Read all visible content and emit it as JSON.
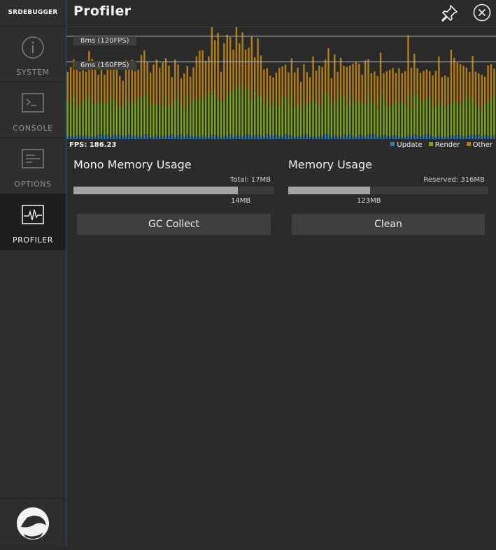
{
  "app": {
    "brand": "SRDEBUGGER"
  },
  "sidebar": {
    "items": [
      {
        "label": "SYSTEM",
        "icon": "info-icon",
        "active": false
      },
      {
        "label": "CONSOLE",
        "icon": "terminal-icon",
        "active": false
      },
      {
        "label": "OPTIONS",
        "icon": "options-list-icon",
        "active": false
      },
      {
        "label": "PROFILER",
        "icon": "heartbeat-icon",
        "active": true
      }
    ],
    "logo_icon": "srdebugger-logo-icon"
  },
  "header": {
    "title": "Profiler",
    "pin_icon": "pin-icon",
    "close_icon": "close-icon"
  },
  "profiler": {
    "threshold_8ms": "8ms (120FPS)",
    "threshold_6ms": "6ms (160FPS)",
    "fps_label": "FPS: 186.23",
    "legend": [
      {
        "label": "Update",
        "color": "#2f7fb6"
      },
      {
        "label": "Render",
        "color": "#7ca515"
      },
      {
        "label": "Other",
        "color": "#b57e10"
      }
    ]
  },
  "chart_data": {
    "type": "bar",
    "stacked": true,
    "series_names": [
      "Update",
      "Render",
      "Other"
    ],
    "thresholds_ms": [
      8,
      6
    ],
    "ylim_ms": [
      0,
      8.7
    ],
    "frames": 140,
    "seed": 7
  },
  "mono_memory": {
    "title": "Mono Memory Usage",
    "total_prefix": "Total: ",
    "total_value": "17MB",
    "used_value": "14MB",
    "used_fraction": 0.82,
    "button": "GC Collect"
  },
  "memory": {
    "title": "Memory Usage",
    "reserved_prefix": "Reserved: ",
    "reserved_value": "316MB",
    "used_value": "123MB",
    "used_fraction": 0.41,
    "button": "Clean"
  },
  "colors": {
    "update": "#2f7fb6",
    "render": "#7ca515",
    "other": "#b57e10",
    "panel": "#2b2b2b",
    "sidebar": "#2e2e2e",
    "sidebar_active": "#1e1e1e",
    "button": "#3f3f3f"
  }
}
